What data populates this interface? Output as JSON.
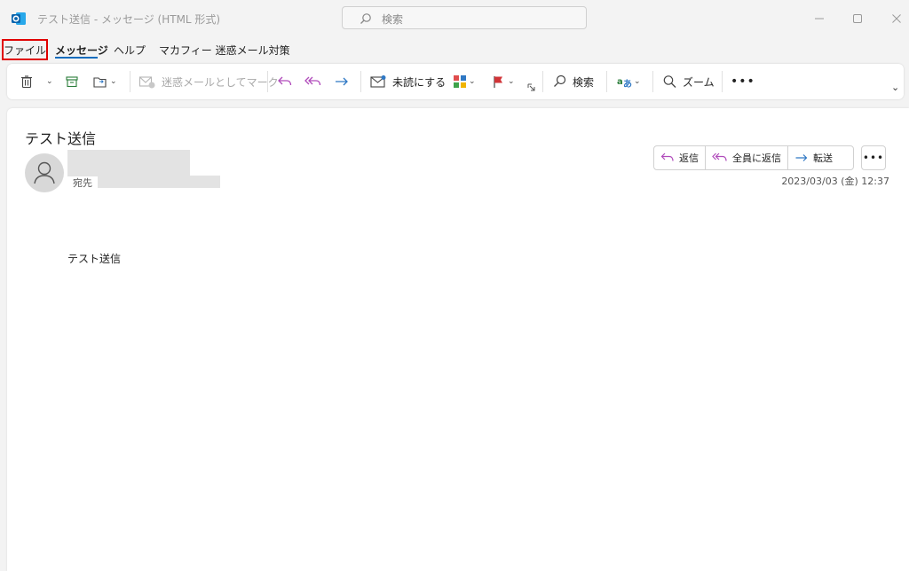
{
  "window": {
    "title": "テスト送信  -  メッセージ (HTML 形式)",
    "search_placeholder": "検索"
  },
  "tabs": {
    "file": "ファイル",
    "message": "メッセージ",
    "help": "ヘルプ",
    "mcafee": "マカフィー 迷惑メール対策"
  },
  "ribbon": {
    "junk": "迷惑メールとしてマーク",
    "unread": "未読にする",
    "search": "検索",
    "zoom": "ズーム"
  },
  "email": {
    "subject": "テスト送信",
    "to_label": "宛先",
    "reply": "返信",
    "reply_all": "全員に返信",
    "forward": "転送",
    "date": "2023/03/03 (金) 12:37",
    "body": "テスト送信"
  },
  "colors": {
    "accent": "#0f6cbd",
    "highlight": "#e00000",
    "reply_purple": "#b04bbb",
    "forward_blue": "#2f78c4"
  }
}
